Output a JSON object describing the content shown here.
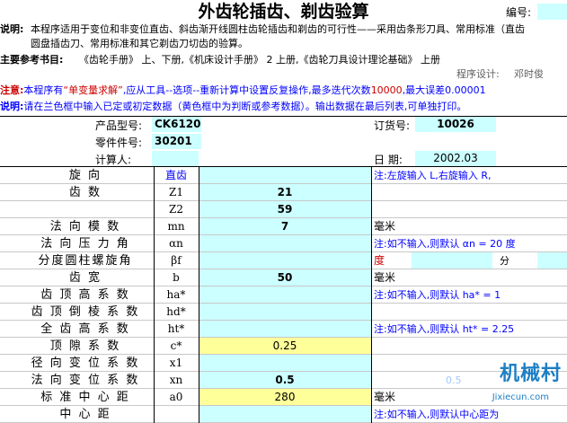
{
  "header": {
    "title": "外齿轮插齿、剃齿验算",
    "number_label": "编号:",
    "desc_label": "说明:",
    "desc_line1": "本程序适用于变位和非变位直齿、斜齿渐开线圆柱齿轮插齿和剃齿的可行性——采用齿条形刀具、常用标准（直齿",
    "desc_line2": "圆盘插齿刀、常用标准和其它剃齿刀切齿的验算。",
    "refs_label": "主要参考书目:",
    "refs": "《齿轮手册》 上、下册,《机床设计手册》 2  上册,《齿轮刀具设计理论基础》    上册",
    "designer_label": "程序设计:",
    "designer": "邓时俊",
    "notice_label": "注意:",
    "notice_pre": "本程序有",
    "notice_req": "“单变量求解”",
    "notice_mid": ",应从工具--选项--重新计算中设置反复操作,最多迭代次数",
    "notice_iter": "10000",
    "notice_err": ",最大误差0.00001",
    "usage_label": "说明:",
    "usage": "请在兰色框中输入已定或初定数据（黄色框中为判断或参考数据）。输出数据在最后列表,可单独打印。"
  },
  "info": {
    "product_label": "产品型号:",
    "product_value": "CK6120",
    "part_label": "零件件号:",
    "part_value": "30201",
    "calc_label": "计算人:",
    "calc_value": "",
    "order_label": "订货号:",
    "order_value": "10026",
    "date_label": "日  期:",
    "date_value": "2002.03"
  },
  "rows": [
    {
      "name": "旋        向",
      "sym": "直齿",
      "value": "",
      "unit": "",
      "hint": "注:左旋输入 L,右旋输入 R,",
      "value_style": "cyan"
    },
    {
      "name": "齿        数",
      "sym": "Z1",
      "value": "21",
      "unit": "",
      "hint": "",
      "value_style": "cyan"
    },
    {
      "name": "",
      "sym": "Z2",
      "value": "59",
      "unit": "",
      "hint": "",
      "value_style": "cyan"
    },
    {
      "name": "法 向 模 数",
      "sym": "mn",
      "value": "7",
      "unit": "毫米",
      "hint": "",
      "value_style": "cyan"
    },
    {
      "name": "法 向 压 力 角",
      "sym": "αn",
      "value": "",
      "unit": "",
      "hint": "注:如不输入,则默认 αn = 20 度",
      "value_style": "cyan"
    },
    {
      "name": "分度圆柱螺旋角",
      "sym": "βf",
      "value": "",
      "unit": "度",
      "hint": "分",
      "value_style": "cyan"
    },
    {
      "name": "齿        宽",
      "sym": "b",
      "value": "50",
      "unit": "毫米",
      "hint": "",
      "value_style": "cyan"
    },
    {
      "name": "齿 顶 高 系 数",
      "sym": "ha*",
      "value": "",
      "unit": "",
      "hint": "注:如不输入,则默认 ha* = 1",
      "value_style": "cyan"
    },
    {
      "name": "齿 顶 倒 棱 系 数",
      "sym": "hd*",
      "value": "",
      "unit": "",
      "hint": "",
      "value_style": "cyan"
    },
    {
      "name": "全 齿 高 系 数",
      "sym": "ht*",
      "value": "",
      "unit": "",
      "hint": "注:如不输入,则默认 ht* = 2.25",
      "value_style": "cyan"
    },
    {
      "name": "顶  隙  系  数",
      "sym": "c*",
      "value": "0.25",
      "unit": "",
      "hint": "",
      "value_style": "yellow"
    },
    {
      "name": "径 向 变 位 系 数",
      "sym": "x1",
      "value": "",
      "unit": "",
      "hint": "",
      "value_style": "cyan"
    },
    {
      "name": "法 向 变 位 系 数",
      "sym": "xn",
      "value": "0.5",
      "unit": "",
      "hint": "0.5",
      "value_style": "cyan"
    },
    {
      "name": "标 准 中 心 距",
      "sym": "a0",
      "value": "280",
      "unit": "毫米",
      "hint": "",
      "value_style": "yellow"
    },
    {
      "name": "中  心  距",
      "sym": "",
      "value": "",
      "unit": "",
      "hint": "注:如不输入,则默认中心距为",
      "value_style": "cyan"
    }
  ],
  "watermark": {
    "main": "机械村",
    "sub": "Jixiecun.com"
  },
  "colors": {
    "input_cyan": "#ccffff",
    "ref_yellow": "#ffff99",
    "note_blue": "#0000ff",
    "alert_red": "#cc0000"
  }
}
